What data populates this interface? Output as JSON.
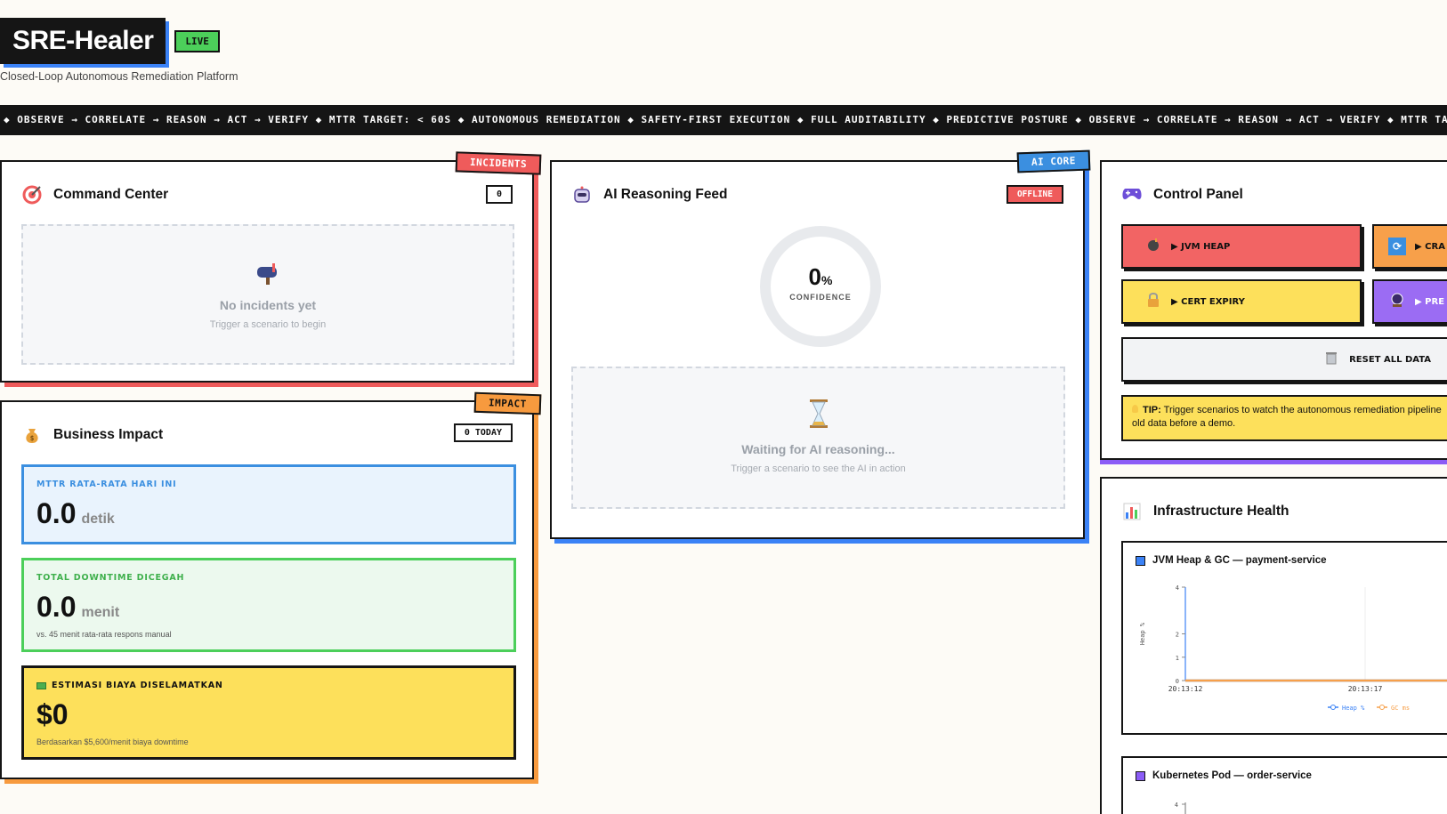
{
  "header": {
    "app_name": "SRE-Healer",
    "live_badge": "LIVE",
    "subtitle": "Closed-Loop Autonomous Remediation Platform"
  },
  "ticker": {
    "text": "◆ OBSERVE → CORRELATE → REASON → ACT → VERIFY ◆ MTTR TARGET: < 60S ◆ AUTONOMOUS REMEDIATION ◆ SAFETY-FIRST EXECUTION ◆ FULL AUDITABILITY ◆ PREDICTIVE POSTURE ◆ OBSERVE → CORRELATE → REASON → ACT → VERIFY ◆ MTTR TARGET: < 60S ◆"
  },
  "command_center": {
    "tag": "INCIDENTS",
    "title": "Command Center",
    "count": "0",
    "empty_title": "No incidents yet",
    "empty_sub": "Trigger a scenario to begin",
    "icon": "target-icon"
  },
  "business_impact": {
    "tag": "IMPACT",
    "title": "Business Impact",
    "count": "0 TODAY",
    "mttr": {
      "label": "MTTR RATA-RATA HARI INI",
      "value": "0.0",
      "unit": "detik"
    },
    "downtime": {
      "label": "TOTAL DOWNTIME DICEGAH",
      "value": "0.0",
      "unit": "menit",
      "note": "vs. 45 menit rata-rata respons manual"
    },
    "cost": {
      "label": "ESTIMASI BIAYA DISELAMATKAN",
      "value": "$0",
      "note": "Berdasarkan $5,600/menit biaya downtime"
    }
  },
  "ai_feed": {
    "tag": "AI CORE",
    "title": "AI Reasoning Feed",
    "status": "OFFLINE",
    "confidence_value": "0",
    "confidence_unit": "%",
    "confidence_label": "CONFIDENCE",
    "confidence_fraction": 0,
    "waiting_title": "Waiting for AI reasoning...",
    "waiting_sub": "Trigger a scenario to see the AI in action"
  },
  "control_panel": {
    "title": "Control Panel",
    "buttons": [
      {
        "label": "▶ JVM HEAP",
        "color": "#f26464",
        "icon": "bomb-icon"
      },
      {
        "label": "▶ CRA",
        "color": "#f7a04a",
        "icon": "refresh-icon"
      },
      {
        "label": "▶ CERT EXPIRY",
        "color": "#fde05b",
        "icon": "lock-icon"
      },
      {
        "label": "▶ PRE",
        "color": "#9b6cf3",
        "icon": "crystal-ball-icon"
      }
    ],
    "reset_label": "RESET ALL DATA",
    "tip_bold": "TIP:",
    "tip_text": " Trigger scenarios to watch the autonomous remediation pipeline",
    "tip_text2": "old data before a demo."
  },
  "infrastructure": {
    "title": "Infrastructure Health",
    "charts": [
      {
        "title": "JVM Heap & GC — payment-service",
        "color": "#3b82f6"
      },
      {
        "title": "Kubernetes Pod — order-service",
        "color": "#8b5cf6"
      }
    ]
  },
  "chart_data": [
    {
      "type": "line",
      "title": "JVM Heap & GC — payment-service",
      "ylabel": "Heap %",
      "x": [
        "20:13:12",
        "20:13:17"
      ],
      "yticks": [
        "0",
        "1",
        "2",
        "4"
      ],
      "series": [
        {
          "name": "Heap %",
          "values": [
            0,
            0
          ],
          "color": "#3b82f6"
        },
        {
          "name": "GC ms",
          "values": [
            0,
            0
          ],
          "color": "#f7a04a"
        }
      ],
      "legend": "bottom"
    },
    {
      "type": "line",
      "title": "Kubernetes Pod — order-service",
      "yticks": [
        "4"
      ],
      "series": []
    }
  ]
}
